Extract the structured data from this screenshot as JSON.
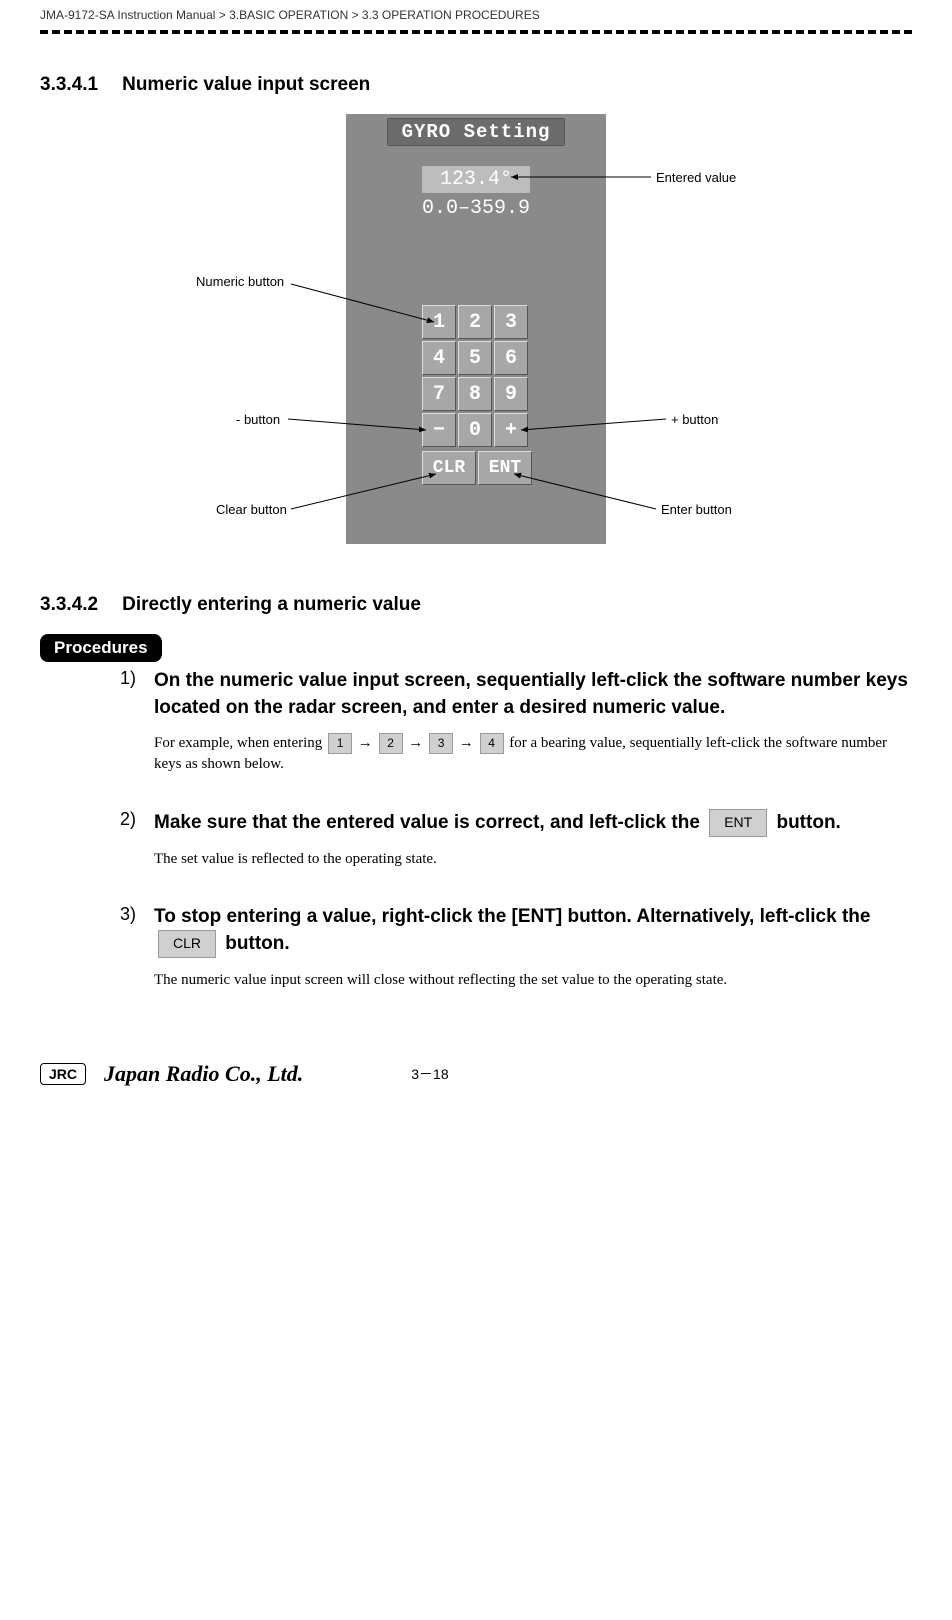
{
  "breadcrumb": "JMA-9172-SA Instruction Manual > 3.BASIC OPERATION > 3.3  OPERATION PROCEDURES",
  "sec1": {
    "num": "3.3.4.1",
    "title": "Numeric value input screen"
  },
  "figure": {
    "panel_title": "GYRO Setting",
    "value": "123.4°",
    "range": "0.0–359.9",
    "keys": {
      "1": "1",
      "2": "2",
      "3": "3",
      "4": "4",
      "5": "5",
      "6": "6",
      "7": "7",
      "8": "8",
      "9": "9",
      "minus": "−",
      "0": "0",
      "plus": "+",
      "clr": "CLR",
      "ent": "ENT"
    },
    "labels": {
      "entered": "Entered value",
      "numeric": "Numeric button",
      "minus": "- button",
      "clear": "Clear button",
      "plus": "+ button",
      "enter": "Enter button"
    }
  },
  "sec2": {
    "num": "3.3.4.2",
    "title": "Directly entering a numeric value"
  },
  "procedures_label": "Procedures",
  "steps": {
    "s1": {
      "num": "1)",
      "title": "On the numeric value input screen, sequentially left-click the software number keys located on the radar screen, and enter a desired numeric value.",
      "body_a": "For example, when entering ",
      "k1": "1",
      "arrow": " → ",
      "k2": "2",
      "k3": "3",
      "k4": "4",
      "body_b": " for a bearing value, sequentially left-click the software number keys as shown below."
    },
    "s2": {
      "num": "2)",
      "title_a": "Make sure that the entered value is correct, and left-click the ",
      "btn": "ENT",
      "title_b": " button.",
      "body": "The set value is reflected to the operating state."
    },
    "s3": {
      "num": "3)",
      "title_a": "To stop entering a value, right-click the [ENT] button. Alternatively, left-click the ",
      "btn": "CLR",
      "title_b": "  button.",
      "body": "The numeric value input screen will close without reflecting the set value to the operating state."
    }
  },
  "footer": {
    "jrc": "JRC",
    "company": "Japan Radio Co., Ltd.",
    "page": "3－18"
  }
}
